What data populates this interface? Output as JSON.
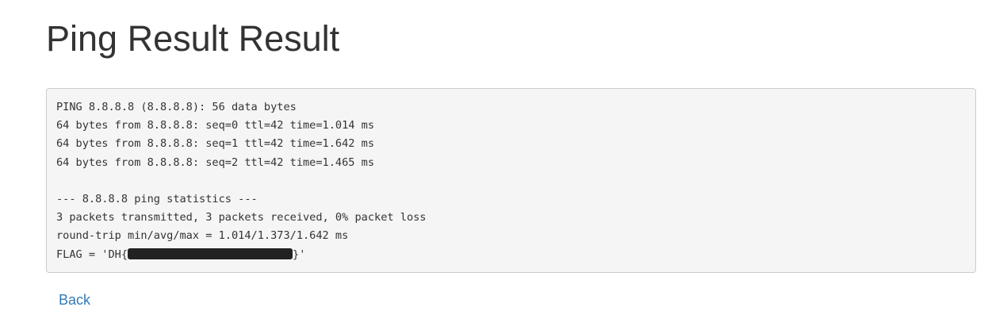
{
  "page": {
    "title": "Ping Result Result"
  },
  "output": {
    "lines": [
      "PING 8.8.8.8 (8.8.8.8): 56 data bytes",
      "64 bytes from 8.8.8.8: seq=0 ttl=42 time=1.014 ms",
      "64 bytes from 8.8.8.8: seq=1 ttl=42 time=1.642 ms",
      "64 bytes from 8.8.8.8: seq=2 ttl=42 time=1.465 ms",
      "",
      "--- 8.8.8.8 ping statistics ---",
      "3 packets transmitted, 3 packets received, 0% packet loss",
      "round-trip min/avg/max = 1.014/1.373/1.642 ms"
    ],
    "flag": {
      "prefix": "FLAG = 'DH{",
      "suffix": "}'"
    }
  },
  "nav": {
    "back_label": "Back"
  }
}
